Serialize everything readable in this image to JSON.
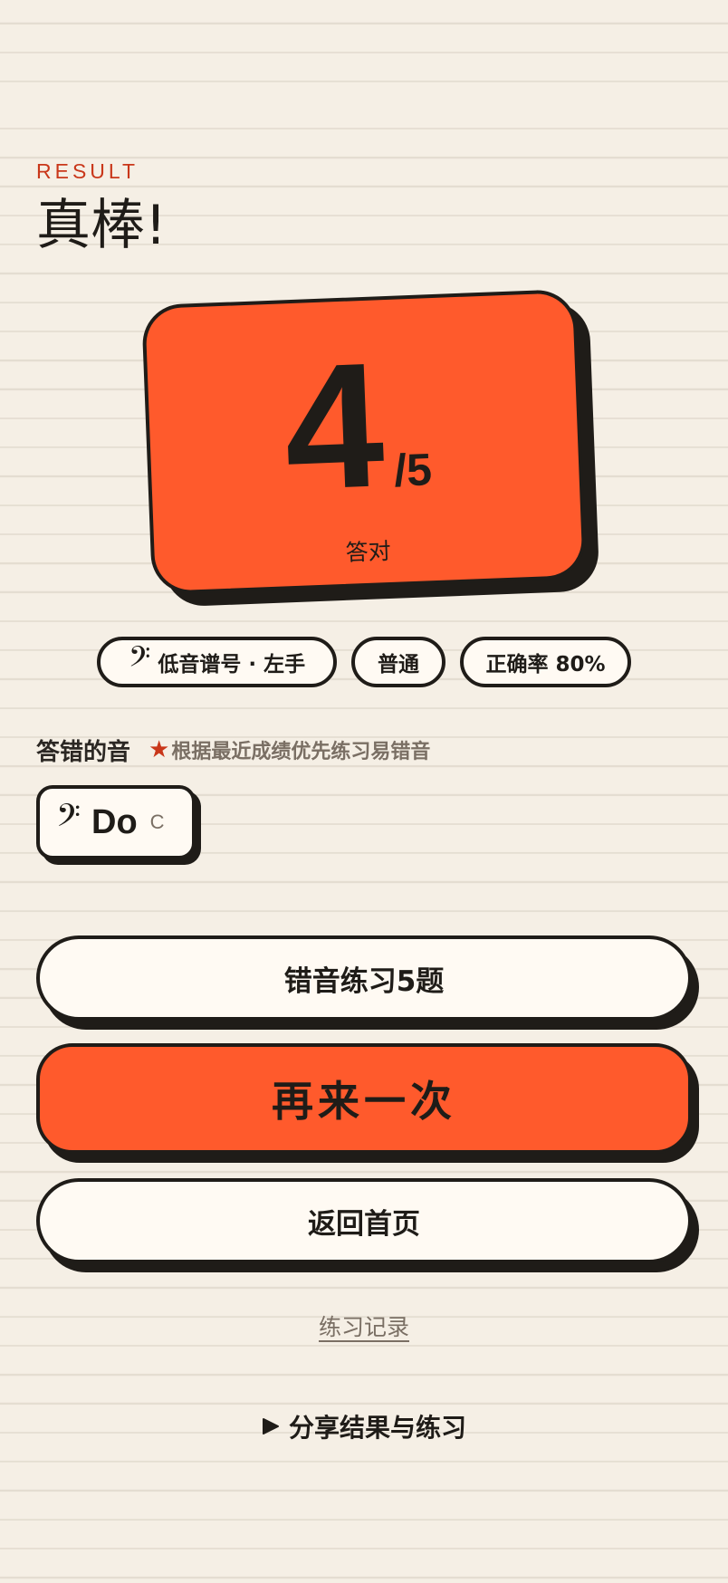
{
  "header": {
    "eyebrow": "RESULT",
    "headline": "真棒!"
  },
  "score": {
    "correct": "4",
    "total": "/5",
    "label": "答对"
  },
  "tags": {
    "clef_glyph": "𝄢",
    "clef_mode": "低音谱号 · 左手",
    "difficulty": "普通",
    "accuracy": "正确率 80%"
  },
  "mistakes": {
    "title": "答错的音",
    "hint_star": "★",
    "hint": "根据最近成绩优先练习易错音",
    "notes": [
      {
        "clef": "𝄢",
        "solfege": "Do",
        "letter": "C"
      }
    ]
  },
  "actions": {
    "review_label": "错音练习5题",
    "again_label": "再来一次",
    "home_label": "返回首页",
    "history_label": "练习记录",
    "share_label": "分享结果与练习"
  },
  "colors": {
    "accent": "#ff5a2c",
    "ink": "#1f1c18",
    "background": "#f5efe5",
    "eyebrow": "#c9371a"
  }
}
